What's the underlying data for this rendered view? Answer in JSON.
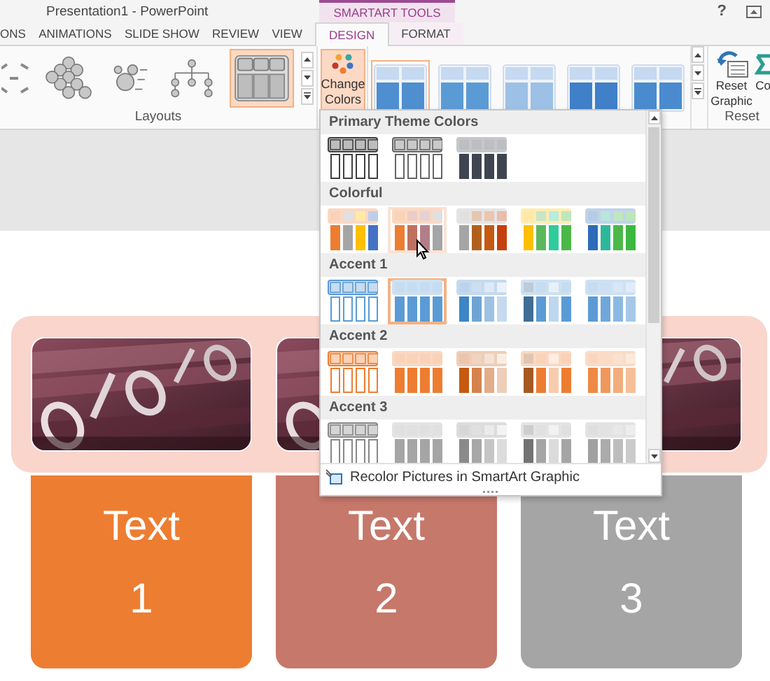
{
  "title_bar": {
    "title": "Presentation1 - PowerPoint",
    "context_header": "SMARTART TOOLS",
    "help": "?"
  },
  "tabs": [
    {
      "label": "ONS",
      "selected": false,
      "contextual": false
    },
    {
      "label": "ANIMATIONS",
      "selected": false,
      "contextual": false
    },
    {
      "label": "SLIDE SHOW",
      "selected": false,
      "contextual": false
    },
    {
      "label": "REVIEW",
      "selected": false,
      "contextual": false
    },
    {
      "label": "VIEW",
      "selected": false,
      "contextual": false
    },
    {
      "label": "DESIGN",
      "selected": true,
      "contextual": true
    },
    {
      "label": "FORMAT",
      "selected": false,
      "contextual": true
    }
  ],
  "ribbon": {
    "layouts": {
      "label": "Layouts",
      "items": [
        {
          "kind": "bracket",
          "selected": false
        },
        {
          "kind": "hexagon",
          "selected": false
        },
        {
          "kind": "bubble",
          "selected": false
        },
        {
          "kind": "hierarchy",
          "selected": false
        },
        {
          "kind": "picture-list",
          "selected": true
        }
      ]
    },
    "change_colors": {
      "label": "Change Colors",
      "active": true
    },
    "styles": [
      {
        "color": "#4f8fd0",
        "selected": true
      },
      {
        "color": "#5b9bd5",
        "selected": false
      },
      {
        "color": "#9dc0e6",
        "selected": false
      },
      {
        "color": "#3f80c8",
        "selected": false
      },
      {
        "color": "#4a8bcf",
        "selected": false
      }
    ],
    "reset": {
      "label": "Reset",
      "buttons": [
        {
          "kind": "reset",
          "label": "Reset Graphic"
        },
        {
          "kind": "convert",
          "label": "Co"
        }
      ]
    }
  },
  "slide": {
    "shapes": [
      {
        "title": "Text",
        "number": "1",
        "color": "#ed7d31"
      },
      {
        "title": "Text",
        "number": "2",
        "color": "#c6786a"
      },
      {
        "title": "Text",
        "number": "3",
        "color": "#a5a5a5"
      }
    ]
  },
  "dropdown": {
    "sections": [
      {
        "title": "Primary Theme Colors",
        "options": [
          {
            "kind": "outline",
            "color": "#404040",
            "selected": false,
            "hovered": false
          },
          {
            "kind": "outline",
            "color": "#666666",
            "selected": false,
            "hovered": false
          },
          {
            "kind": "solid",
            "color": "#3f4550",
            "selected": false,
            "hovered": false
          }
        ]
      },
      {
        "title": "Colorful",
        "options": [
          {
            "kind": "multi",
            "color": "#ed7d31",
            "selected": false,
            "hovered": false
          },
          {
            "kind": "multi",
            "color": "#ed7d31",
            "selected": false,
            "hovered": true
          },
          {
            "kind": "multi",
            "color": "#a5a5a5",
            "selected": false,
            "hovered": false
          },
          {
            "kind": "multi",
            "color": "#ffc000",
            "selected": false,
            "hovered": false
          },
          {
            "kind": "multi",
            "color": "#2e6bb8",
            "selected": false,
            "hovered": false
          }
        ]
      },
      {
        "title": "Accent 1",
        "options": [
          {
            "kind": "outline",
            "color": "#5b9bd5",
            "selected": false,
            "hovered": false
          },
          {
            "kind": "solid",
            "color": "#5b9bd5",
            "selected": true,
            "hovered": false
          },
          {
            "kind": "fade",
            "color": "#3d85c6",
            "selected": false,
            "hovered": false
          },
          {
            "kind": "dark-first",
            "color": "#5b9bd5",
            "selected": false,
            "hovered": false
          },
          {
            "kind": "soft",
            "color": "#5b9bd5",
            "selected": false,
            "hovered": false
          }
        ]
      },
      {
        "title": "Accent 2",
        "options": [
          {
            "kind": "outline",
            "color": "#ed7d31",
            "selected": false,
            "hovered": false
          },
          {
            "kind": "solid",
            "color": "#ed7d31",
            "selected": false,
            "hovered": false
          },
          {
            "kind": "fade",
            "color": "#c55a11",
            "selected": false,
            "hovered": false
          },
          {
            "kind": "dark-first",
            "color": "#ed7d31",
            "selected": false,
            "hovered": false
          },
          {
            "kind": "soft",
            "color": "#ed8a45",
            "selected": false,
            "hovered": false
          }
        ]
      },
      {
        "title": "Accent 3",
        "options": [
          {
            "kind": "outline",
            "color": "#888888",
            "selected": false,
            "hovered": false
          },
          {
            "kind": "solid",
            "color": "#a5a5a5",
            "selected": false,
            "hovered": false
          },
          {
            "kind": "fade",
            "color": "#8a8a8a",
            "selected": false,
            "hovered": false
          },
          {
            "kind": "dark-first",
            "color": "#a5a5a5",
            "selected": false,
            "hovered": false
          },
          {
            "kind": "soft",
            "color": "#a0a0a0",
            "selected": false,
            "hovered": false
          }
        ]
      }
    ],
    "footer": "Recolor Pictures in SmartArt Graphic"
  }
}
